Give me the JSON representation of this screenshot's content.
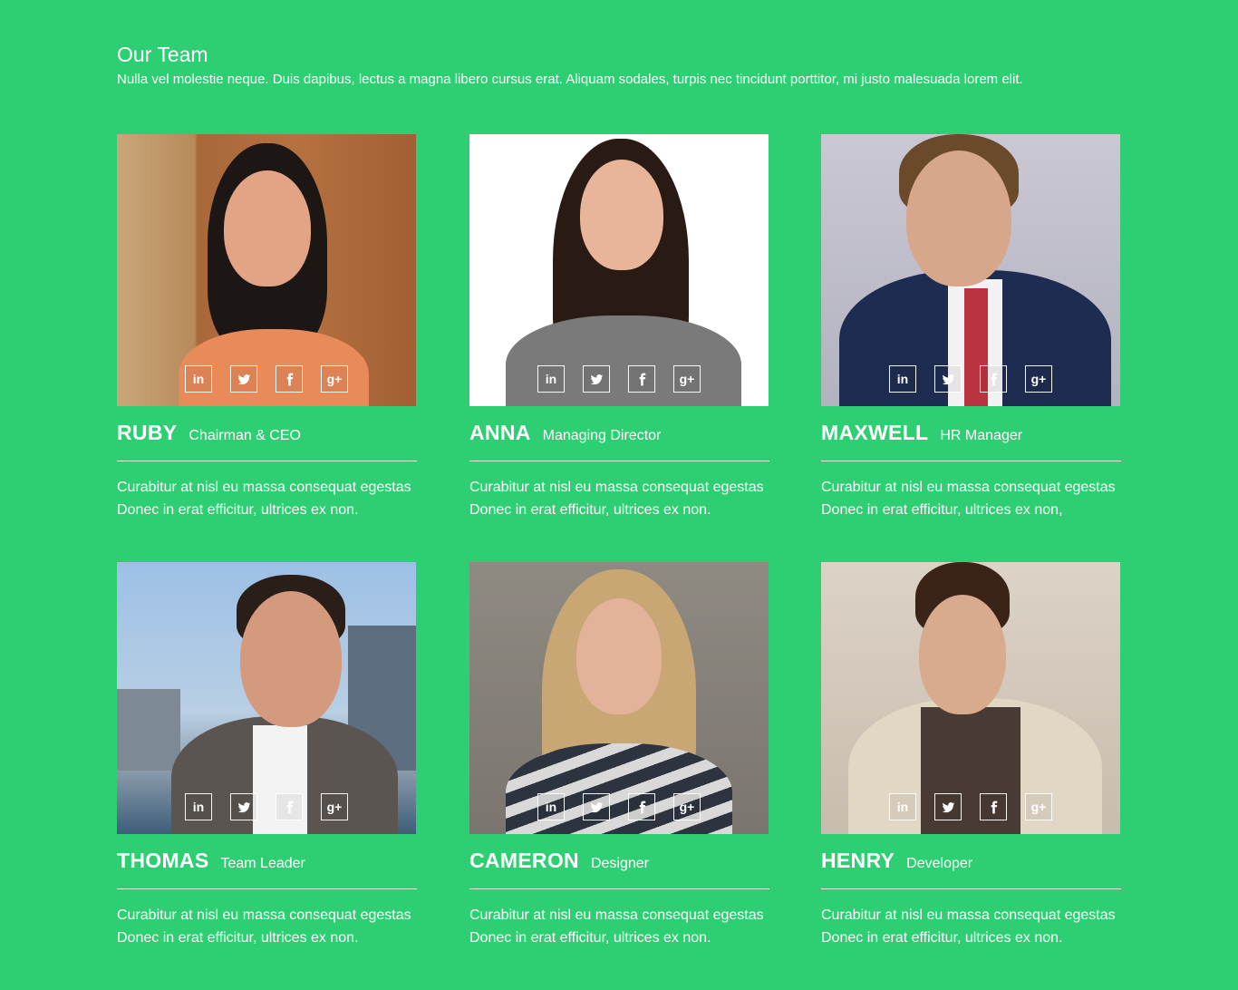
{
  "section": {
    "title": "Our Team",
    "subtitle": "Nulla vel molestie neque. Duis dapibus, lectus a magna libero cursus erat. Aliquam sodales, turpis nec tincidunt porttitor, mi justo malesuada lorem elit."
  },
  "social_icons": [
    "linkedin-icon",
    "twitter-icon",
    "facebook-icon",
    "google-plus-icon"
  ],
  "social_labels": {
    "linkedin": "in",
    "google": "g+"
  },
  "colors": {
    "background": "#2ecf72",
    "text": "#ffffff"
  },
  "members": [
    {
      "name": "RUBY",
      "role": "Chairman & CEO",
      "description_line1": "Curabitur at nisl eu massa consequat egestas",
      "description_line2": "Donec in erat efficitur, ultrices ex non."
    },
    {
      "name": "ANNA",
      "role": "Managing Director",
      "description_line1": "Curabitur at nisl eu massa consequat egestas",
      "description_line2": "Donec in erat efficitur, ultrices ex non."
    },
    {
      "name": "MAXWELL",
      "role": "HR Manager",
      "description_line1": "Curabitur at nisl eu massa consequat egestas",
      "description_line2": "Donec in erat efficitur, ultrices ex non,"
    },
    {
      "name": "THOMAS",
      "role": "Team Leader",
      "description_line1": "Curabitur at nisl eu massa consequat egestas",
      "description_line2": "Donec in erat efficitur, ultrices ex non."
    },
    {
      "name": "CAMERON",
      "role": "Designer",
      "description_line1": "Curabitur at nisl eu massa consequat egestas",
      "description_line2": "Donec in erat efficitur, ultrices ex non."
    },
    {
      "name": "HENRY",
      "role": "Developer",
      "description_line1": "Curabitur at nisl eu massa consequat egestas",
      "description_line2": "Donec in erat efficitur, ultrices ex non."
    }
  ]
}
